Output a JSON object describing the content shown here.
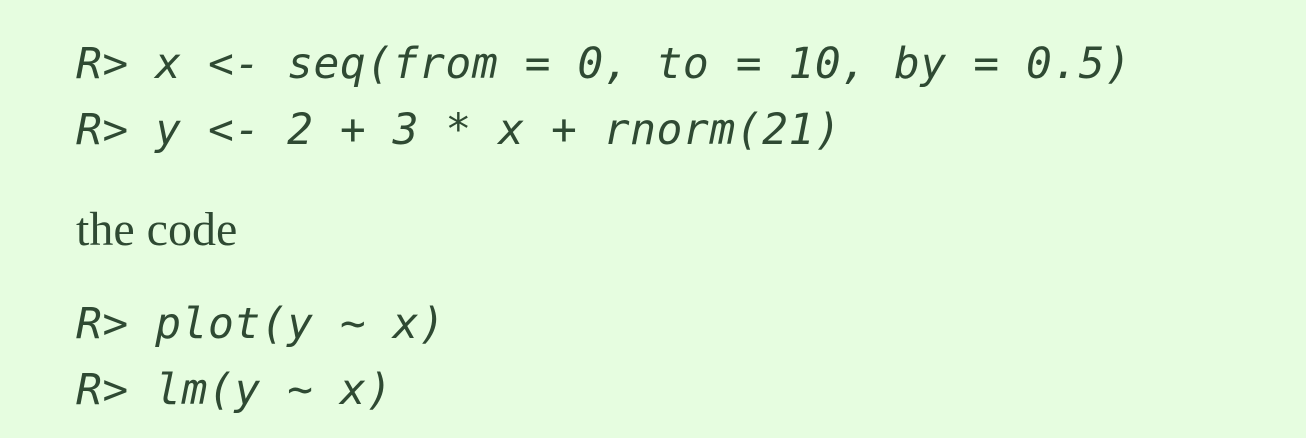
{
  "code_block_1": {
    "lines": [
      "R> x <- seq(from = 0, to = 10, by = 0.5)",
      "R> y <- 2 + 3 * x + rnorm(21)"
    ]
  },
  "prose": {
    "text": "the code"
  },
  "code_block_2": {
    "lines": [
      "R> plot(y ~ x)",
      "R> lm(y ~ x)"
    ]
  },
  "colors": {
    "background": "#e6fde0",
    "text": "#2f4a33"
  }
}
